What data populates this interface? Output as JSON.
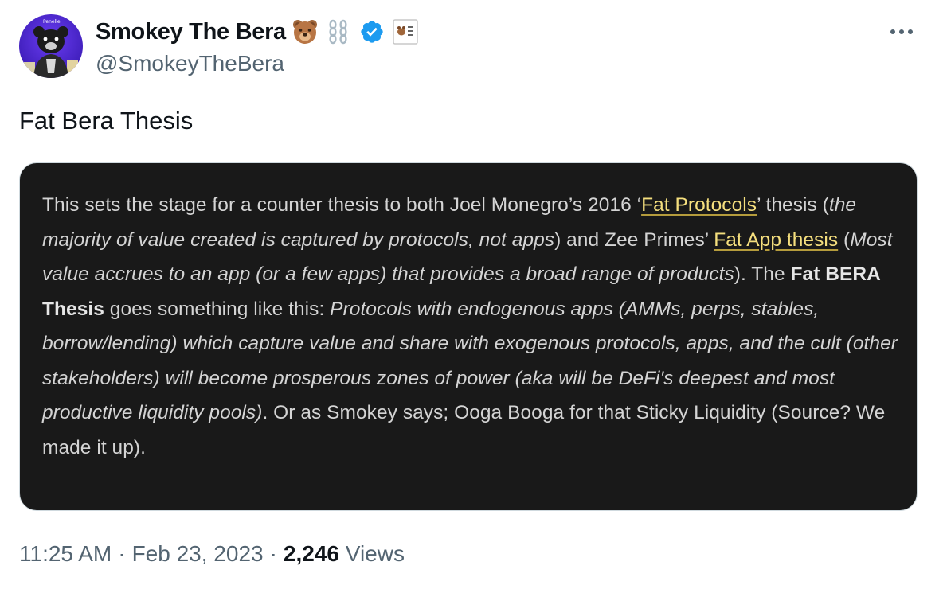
{
  "author": {
    "display_name": "Smokey The Bera",
    "handle": "@SmokeyTheBera",
    "verified": true,
    "avatar_icon": "bear-avatar-icon",
    "name_emojis": [
      "bear-face-icon",
      "chains-icon",
      "verified-badge-icon",
      "bear-codes-icon"
    ]
  },
  "tweet": {
    "text": "Fat Bera Thesis"
  },
  "media": {
    "p1": "This sets the stage for a counter thesis to both Joel Monegro’s 2016 ‘",
    "link1": "Fat Protocols",
    "p2": "’ thesis (",
    "i1": "the majority of value created is captured by protocols, not apps",
    "p3": ") and Zee Primes’ ",
    "link2": "Fat App thesis",
    "p4": " (",
    "i2": "Most value accrues to an app (or a few apps) that provides a broad range of products",
    "p5": "). The ",
    "b1": "Fat BERA Thesis",
    "p6": " goes something like this: ",
    "i3": "Protocols with endogenous apps (AMMs, perps, stables, borrow/lending) which capture value and share with exogenous protocols, apps, and the cult (other stakeholders) will become prosperous zones of power (aka will be DeFi's deepest and most productive liquidity pools)",
    "p7": ". Or as Smokey says; Ooga Booga for that Sticky Liquidity (Source? We made it up).",
    "link_color": "#f5df7e",
    "background": "#191919"
  },
  "meta": {
    "time": "11:25 AM",
    "separator": "·",
    "date": "Feb 23, 2023",
    "views_count": "2,246",
    "views_label": "Views"
  },
  "colors": {
    "verified_blue": "#1d9bf0",
    "secondary_text": "#536471",
    "primary_text": "#0f1419"
  }
}
